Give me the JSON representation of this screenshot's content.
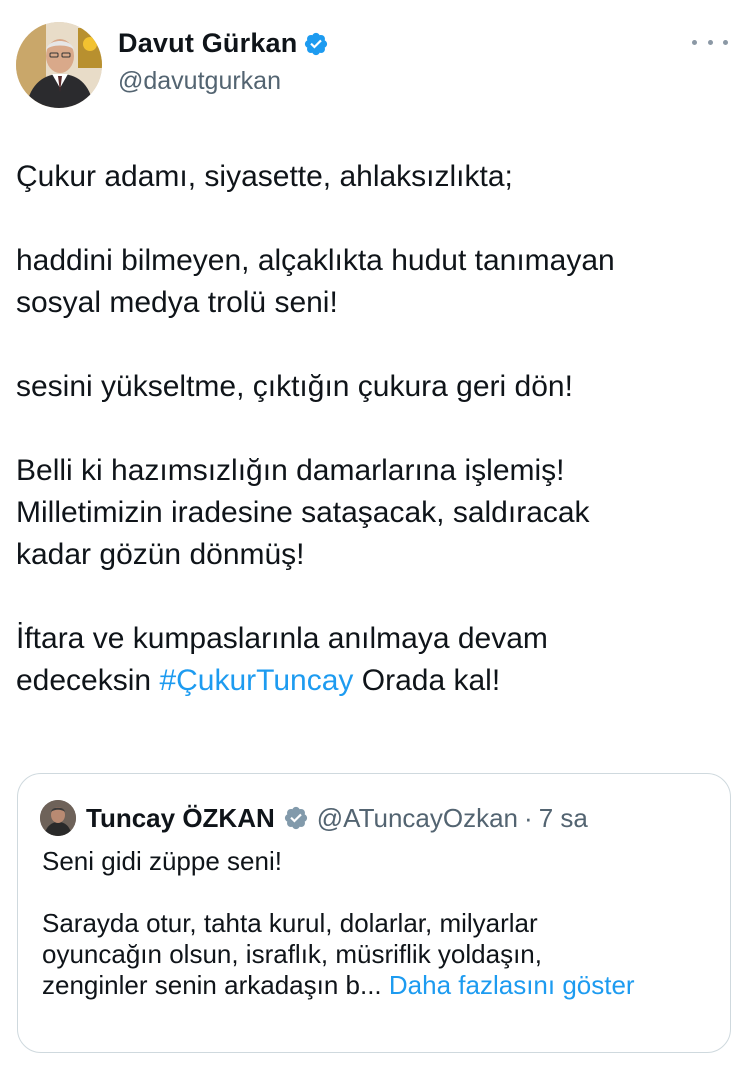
{
  "author": {
    "display_name": "Davut Gürkan",
    "handle": "@davutgurkan",
    "verified": true
  },
  "more_menu": "more-options",
  "tweet": {
    "paragraphs": [
      "Çukur adamı, siyasette, ahlaksızlıkta;",
      "haddini bilmeyen, alçaklıkta hudut tanımayan\nsosyal medya trolü seni!",
      "sesini yükseltme, çıktığın çukura geri dön!",
      "Belli ki hazımsızlığın damarlarına işlemiş!\nMilletimizin iradesine sataşacak, saldıracak\nkadar gözün dönmüş!"
    ],
    "last_paragraph": {
      "before": "İftara ve kumpaslarınla anılmaya devam\nedeceksin ",
      "hashtag": "#ÇukurTuncay",
      "after": " Orada kal!"
    }
  },
  "quoted_tweet": {
    "display_name": "Tuncay ÖZKAN",
    "handle": "@ATuncayOzkan",
    "separator": "·",
    "time": "7 sa",
    "paragraph1": "Seni gidi züppe seni!",
    "paragraph2": "Sarayda otur, tahta kurul, dolarlar, milyarlar\noyuncağın olsun, israflık, müsriflik yoldaşın,\nzenginler senin arkadaşın b...",
    "show_more": "Daha fazlasını göster"
  },
  "colors": {
    "verified_badge": "#1d9bf0",
    "hashtag": "#1d9bf0",
    "muted_text": "#536471",
    "quote_border": "#cfd9de",
    "quote_verified_badge": "#829aab"
  }
}
